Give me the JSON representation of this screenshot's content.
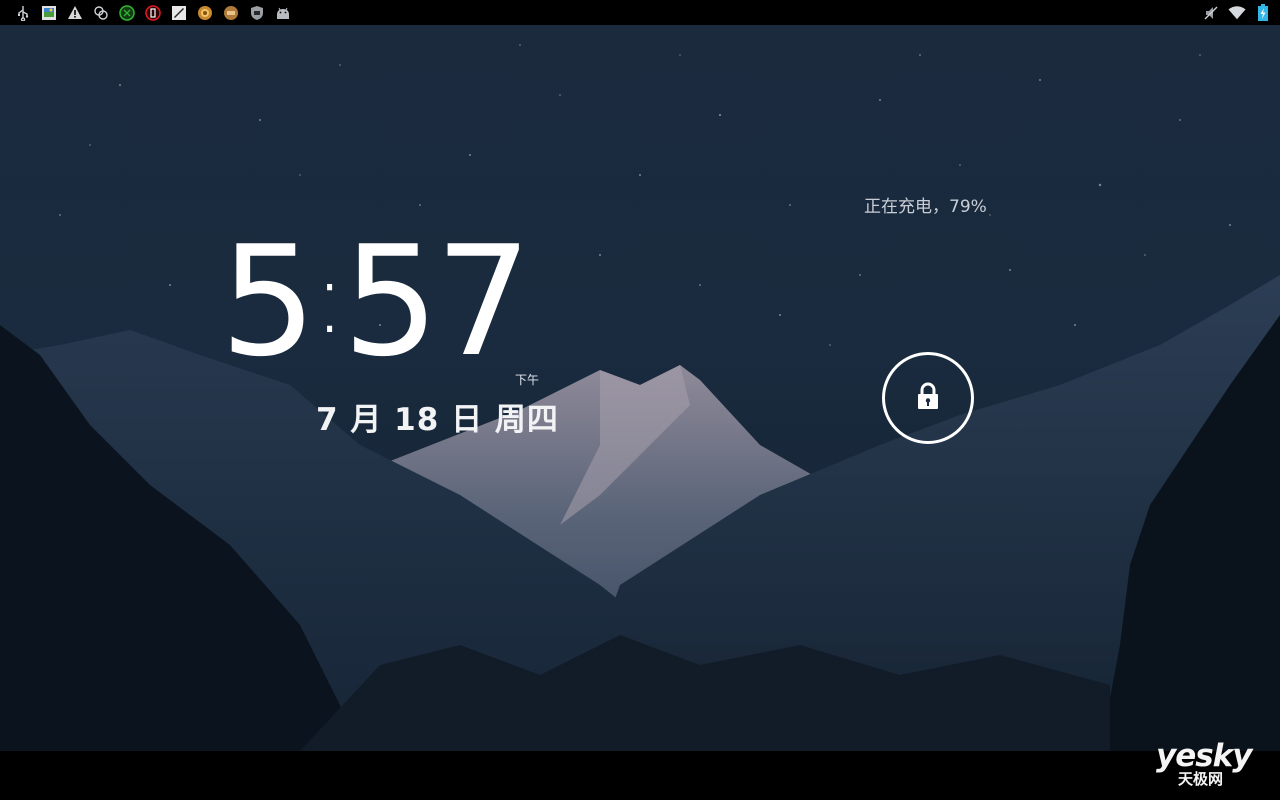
{
  "status_bar": {
    "left_icons": [
      "usb-icon",
      "gallery-icon",
      "warning-icon",
      "sync-icon",
      "app-green-icon",
      "app-red-icon",
      "mail-icon",
      "app-orange-icon",
      "app-brown-icon",
      "app-shield-icon",
      "android-icon"
    ],
    "right_icons": [
      "mute-icon",
      "wifi-icon",
      "battery-charging-icon"
    ]
  },
  "lockscreen": {
    "clock_hour": "5",
    "clock_minute": "57",
    "ampm": "下午",
    "date": "7 月 18 日 周四",
    "charging_status": "正在充电，79%"
  },
  "watermark": {
    "brand": "yesky",
    "subtitle": "天极网"
  },
  "colors": {
    "sky": "#1b2a3d",
    "statusbar": "#000000",
    "text": "#ffffff"
  }
}
